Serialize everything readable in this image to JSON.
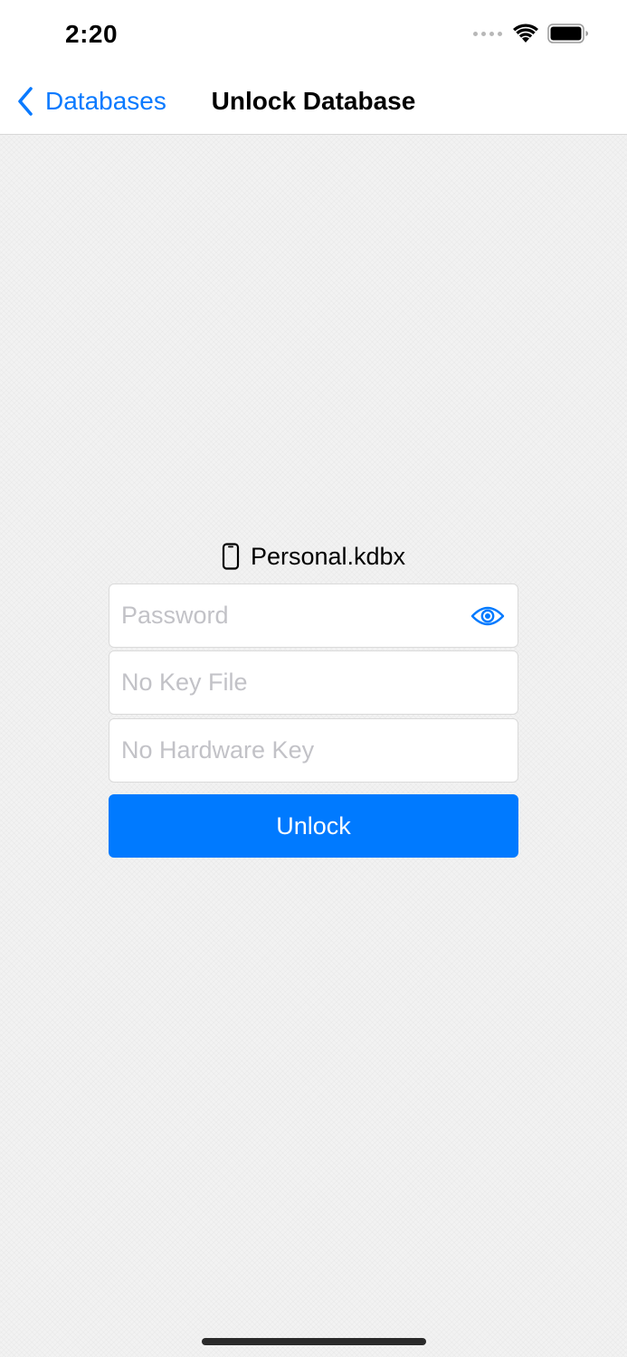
{
  "status_bar": {
    "time": "2:20",
    "icons": [
      "signal-dots-icon",
      "wifi-icon",
      "battery-icon"
    ]
  },
  "nav": {
    "back_label": "Databases",
    "title": "Unlock Database"
  },
  "database": {
    "icon": "phone-icon",
    "name": "Personal.kdbx"
  },
  "form": {
    "password_placeholder": "Password",
    "password_value": "",
    "key_file_text": "No Key File",
    "hardware_key_text": "No Hardware Key",
    "unlock_label": "Unlock"
  },
  "colors": {
    "accent": "#007aff",
    "background": "#f2f2f2",
    "placeholder": "#c2c2c7"
  }
}
